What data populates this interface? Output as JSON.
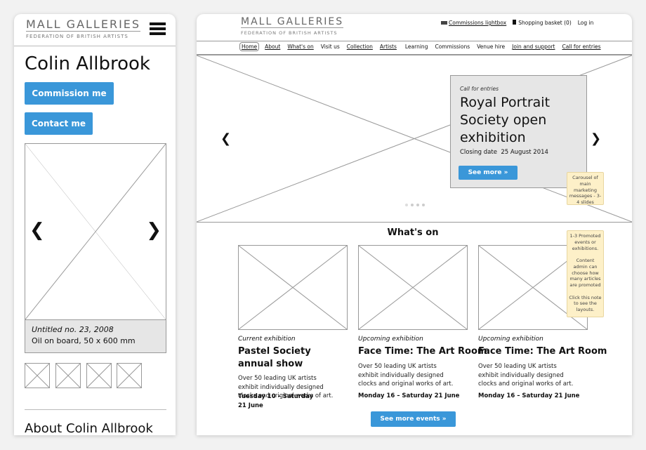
{
  "mobile": {
    "logo": {
      "name": "MALL GALLERIES",
      "tagline": "FEDERATION OF BRITISH ARTISTS"
    },
    "menu_icon": "hamburger-icon",
    "title": "Colin Allbrook",
    "commission_button": "Commission me",
    "contact_button": "Contact me",
    "artwork": {
      "title": "Untitled no. 23, 2008",
      "details": "Oil on board, 50 x 600 mm"
    },
    "about_heading": "About Colin Allbrook"
  },
  "desktop": {
    "logo": {
      "name": "MALL GALLERIES",
      "tagline": "FEDERATION OF BRITISH ARTISTS"
    },
    "utility": {
      "lightbox": "Commissions lightbox",
      "basket": "Shopping basket (0)",
      "login": "Log in"
    },
    "nav": [
      "Home",
      "About",
      "What's on",
      "Visit us",
      "Collection",
      "Artists",
      "Learning",
      "Commissions",
      "Venue hire",
      "Join and support",
      "Call for entries"
    ],
    "hero": {
      "category": "Call for entries",
      "title": "Royal Portrait Society open exhibition",
      "closing": "Closing date  25 August 2014",
      "button": "See more »"
    },
    "hero_note": "Carousel of main marketing messages - 3-4 slides",
    "whats_on": {
      "heading": "What's on",
      "button": "See more events »",
      "events": [
        {
          "category": "Current exhibition",
          "title": "Pastel Society annual show",
          "desc": "Over 50 leading UK artists exhibit individually designed clocks and original works of art.",
          "date": "Tuesday 10 – Saturday 21 June"
        },
        {
          "category": "Upcoming exhibition",
          "title": "Face Time: The Art Room",
          "desc": "Over 50 leading UK artists exhibit individually designed clocks and original works of art.",
          "date": "Monday 16 – Saturday 21 June"
        },
        {
          "category": "Upcoming exhibition",
          "title": "Face Time: The Art Room",
          "desc": "Over 50 leading UK artists exhibit individually designed clocks and original works of art.",
          "date": "Monday 16 – Saturday 21 June"
        }
      ]
    },
    "promo_note": [
      "1-3 Promoted events or exhibitions.",
      "Content admin can choose how many articles are promoted",
      "Click this note to see the layouts."
    ]
  }
}
